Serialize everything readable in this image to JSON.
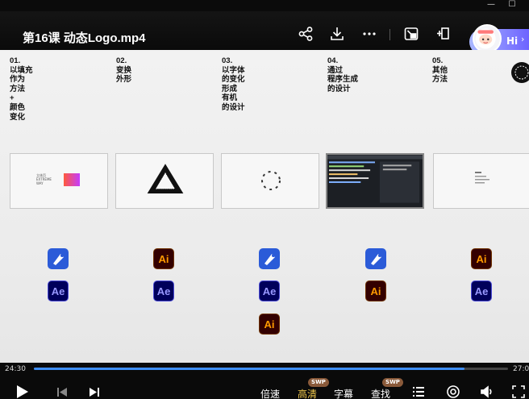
{
  "window": {
    "minimize": "—",
    "maximize": "☐"
  },
  "video": {
    "title": "第16课 动态Logo.mp4"
  },
  "assistant": {
    "label": "Hi"
  },
  "header_icons": [
    "share-icon",
    "download-icon",
    "more-icon",
    "picture-in-picture-icon",
    "pin-icon"
  ],
  "slide": {
    "columns": [
      {
        "heading": "01.\n以填充\n作为\n方法\n+\n颜色\n变化"
      },
      {
        "heading": "02.\n变换\n外形"
      },
      {
        "heading": "03.\n以字体\n的变化\n形成\n有机\n的设计"
      },
      {
        "heading": "04.\n通过\n程序生成\n的设计"
      },
      {
        "heading": "05.\n其他\n方法"
      }
    ],
    "thumb1_text": "立体页\nEXTREME\nWAY",
    "apps": {
      "ae": "Ae",
      "ai": "Ai"
    }
  },
  "playback": {
    "current_time": "24:30",
    "total_time": "27:0",
    "progress": 0.908,
    "controls": {
      "speed": "倍速",
      "quality": "高清",
      "subtitles": "字幕",
      "search": "查找",
      "quality_badge": "SWP",
      "search_badge": "SWP"
    }
  }
}
